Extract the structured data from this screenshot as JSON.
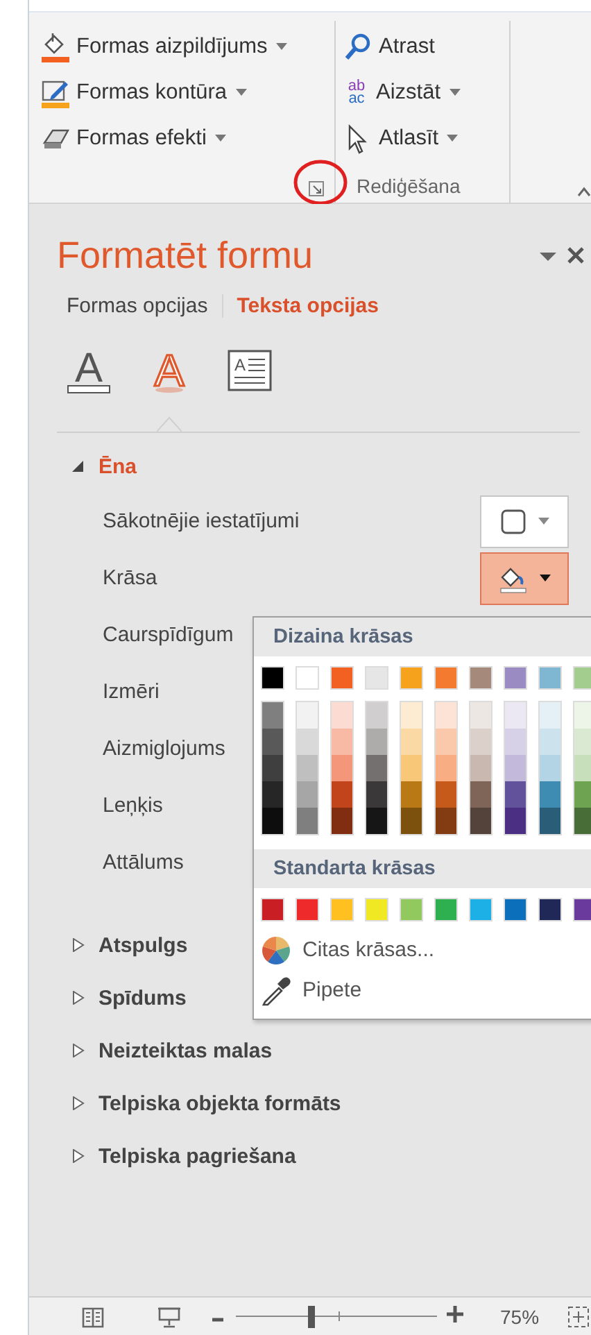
{
  "ribbon": {
    "shape_commands": [
      {
        "label": "Formas aizpildījums",
        "kind": "fill",
        "dropdown": true
      },
      {
        "label": "Formas kontūra",
        "kind": "outline",
        "dropdown": true
      },
      {
        "label": "Formas efekti",
        "kind": "effects",
        "dropdown": true
      }
    ],
    "editing_commands": [
      {
        "label": "Atrast",
        "kind": "find",
        "dropdown": false
      },
      {
        "label": "Aizstāt",
        "kind": "replace",
        "dropdown": true,
        "icon_text": [
          "ab",
          "ac"
        ]
      },
      {
        "label": "Atlasīt",
        "kind": "select",
        "dropdown": true
      }
    ],
    "group_label": "Rediģēšana"
  },
  "pane": {
    "title": "Formatēt formu",
    "tabs": [
      {
        "label": "Formas opcijas",
        "selected": false
      },
      {
        "label": "Teksta opcijas",
        "selected": true
      }
    ],
    "icon_tabs": [
      {
        "kind": "fill",
        "glyph": "A",
        "selected": false
      },
      {
        "kind": "effects",
        "glyph": "A",
        "selected": true
      },
      {
        "kind": "textbox",
        "glyph": "A",
        "selected": false
      }
    ],
    "sections": [
      {
        "label": "Ēna",
        "expanded": true,
        "properties": [
          {
            "label": "Sākotnējie iestatījumi",
            "kind": "preset"
          },
          {
            "label": "Krāsa",
            "kind": "color"
          },
          {
            "label": "Caurspīdīgum",
            "kind": "plain"
          },
          {
            "label": "Izmēri",
            "kind": "plain"
          },
          {
            "label": "Aizmiglojums",
            "kind": "plain"
          },
          {
            "label": "Leņķis",
            "kind": "plain"
          },
          {
            "label": "Attālums",
            "kind": "plain"
          }
        ]
      },
      {
        "label": "Atspulgs",
        "expanded": false
      },
      {
        "label": "Spīdums",
        "expanded": false
      },
      {
        "label": "Neizteiktas malas",
        "expanded": false
      },
      {
        "label": "Telpiska objekta formāts",
        "expanded": false
      },
      {
        "label": "Telpiska pagriešana",
        "expanded": false
      }
    ]
  },
  "color_menu": {
    "theme_heading": "Dizaina krāsas",
    "theme_colors": [
      {
        "color": "#000000",
        "shades": [
          {
            "color": "#7f7f7f"
          },
          {
            "color": "#595959"
          },
          {
            "color": "#3f3f3f"
          },
          {
            "color": "#262626"
          },
          {
            "color": "#0d0d0d"
          }
        ]
      },
      {
        "color": "#ffffff",
        "shades": [
          {
            "color": "#f2f2f2"
          },
          {
            "color": "#d9d9d9"
          },
          {
            "color": "#bfbfbf"
          },
          {
            "color": "#a6a6a6"
          },
          {
            "color": "#7f7f7f"
          }
        ]
      },
      {
        "color": "#f26122",
        "shades": [
          {
            "color": "#fcdcd2"
          },
          {
            "color": "#f8b9a5"
          },
          {
            "color": "#f49679"
          },
          {
            "color": "#c2441a"
          },
          {
            "color": "#812d11"
          }
        ]
      },
      {
        "color": "#e7e6e6",
        "shades": [
          {
            "color": "#d0cece"
          },
          {
            "color": "#aeabab"
          },
          {
            "color": "#757070"
          },
          {
            "color": "#3a3838"
          },
          {
            "color": "#161616"
          }
        ]
      },
      {
        "color": "#f7a21d",
        "shades": [
          {
            "color": "#fdecd2"
          },
          {
            "color": "#fbd9a5"
          },
          {
            "color": "#f9c778"
          },
          {
            "color": "#b97914"
          },
          {
            "color": "#7b510d"
          }
        ]
      },
      {
        "color": "#f37a2f",
        "shades": [
          {
            "color": "#fde3d5"
          },
          {
            "color": "#fac8ab"
          },
          {
            "color": "#f8ae82"
          },
          {
            "color": "#c55a1a"
          },
          {
            "color": "#833c11"
          }
        ]
      },
      {
        "color": "#a5897a",
        "shades": [
          {
            "color": "#ede7e4"
          },
          {
            "color": "#dbd0ca"
          },
          {
            "color": "#c9b8af"
          },
          {
            "color": "#7f6558"
          },
          {
            "color": "#54433a"
          }
        ]
      },
      {
        "color": "#9a8bc3",
        "shades": [
          {
            "color": "#ebe8f3"
          },
          {
            "color": "#d6d1e7"
          },
          {
            "color": "#c2b9db"
          },
          {
            "color": "#62529c"
          },
          {
            "color": "#4b2f83"
          }
        ]
      },
      {
        "color": "#7fb7d3",
        "shades": [
          {
            "color": "#e5f0f6"
          },
          {
            "color": "#cce2ed"
          },
          {
            "color": "#b2d4e4"
          },
          {
            "color": "#3f8cb3"
          },
          {
            "color": "#2a5d77"
          }
        ]
      },
      {
        "color": "#a3cc8f",
        "shades": [
          {
            "color": "#ecf5e8"
          },
          {
            "color": "#dae9d2"
          },
          {
            "color": "#c7e0bb"
          },
          {
            "color": "#6ea352"
          },
          {
            "color": "#496d36"
          }
        ]
      }
    ],
    "standard_heading": "Standarta krāsas",
    "standard_colors": [
      {
        "color": "#c81e24"
      },
      {
        "color": "#ee2a2a"
      },
      {
        "color": "#ffc020"
      },
      {
        "color": "#f0e822"
      },
      {
        "color": "#92c95e"
      },
      {
        "color": "#2eb050"
      },
      {
        "color": "#1cb0e6"
      },
      {
        "color": "#0c6fbc"
      },
      {
        "color": "#202858"
      },
      {
        "color": "#6a3a9c"
      }
    ],
    "actions": [
      {
        "label": "Citas krāsas...",
        "kind": "more"
      },
      {
        "label": "Pipete",
        "kind": "eyedropper"
      }
    ]
  },
  "status_bar": {
    "zoom_slider": {
      "level": 0.37
    },
    "zoom": "75%"
  }
}
